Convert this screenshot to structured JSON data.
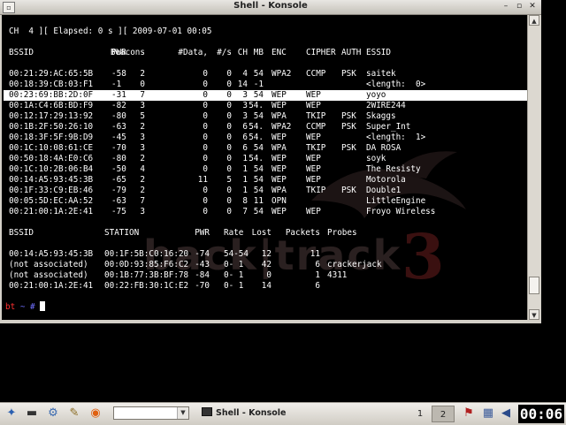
{
  "window": {
    "title": "Shell - Konsole",
    "menu_glyph": "▫",
    "btn_min": "–",
    "btn_max": "▫",
    "btn_close": "✕"
  },
  "terminal": {
    "status_line": "CH  4 ][ Elapsed: 0 s ][ 2009-07-01 00:05",
    "ap_headers": [
      "BSSID",
      "PWR",
      "Beacons",
      "#Data,",
      "#/s",
      "CH",
      "MB",
      "ENC",
      "CIPHER",
      "AUTH",
      "ESSID"
    ],
    "ap_rows": [
      [
        "00:21:29:AC:65:5B",
        "-58",
        "2",
        "0",
        "0",
        "4",
        "54",
        "WPA2",
        "CCMP",
        "PSK",
        "saitek"
      ],
      [
        "00:18:39:CB:03:F1",
        "-1",
        "0",
        "0",
        "0",
        "14",
        "-1",
        "",
        "",
        "",
        "<length:  0>"
      ],
      [
        "00:23:69:BB:2D:0F",
        "-31",
        "7",
        "0",
        "0",
        "3",
        "54",
        "WEP",
        "WEP",
        "",
        "yoyo"
      ],
      [
        "00:1A:C4:6B:BD:F9",
        "-82",
        "3",
        "0",
        "0",
        "3",
        "54.",
        "WEP",
        "WEP",
        "",
        "2WIRE244"
      ],
      [
        "00:12:17:29:13:92",
        "-80",
        "5",
        "0",
        "0",
        "3",
        "54",
        "WPA",
        "TKIP",
        "PSK",
        "Skaggs"
      ],
      [
        "00:1B:2F:50:26:10",
        "-63",
        "2",
        "0",
        "0",
        "6",
        "54.",
        "WPA2",
        "CCMP",
        "PSK",
        "Super_Int"
      ],
      [
        "00:18:3F:5F:9B:D9",
        "-45",
        "3",
        "0",
        "0",
        "6",
        "54.",
        "WEP",
        "WEP",
        "",
        "<length:  1>"
      ],
      [
        "00:1C:10:08:61:CE",
        "-70",
        "3",
        "0",
        "0",
        "6",
        "54",
        "WPA",
        "TKIP",
        "PSK",
        "DA ROSA"
      ],
      [
        "00:50:18:4A:E0:C6",
        "-80",
        "2",
        "0",
        "0",
        "1",
        "54.",
        "WEP",
        "WEP",
        "",
        "soyk"
      ],
      [
        "00:1C:10:2B:06:B4",
        "-50",
        "4",
        "0",
        "0",
        "1",
        "54",
        "WEP",
        "WEP",
        "",
        "The Resisty"
      ],
      [
        "00:14:A5:93:45:3B",
        "-65",
        "2",
        "11",
        "5",
        "1",
        "54",
        "WEP",
        "WEP",
        "",
        "Motorola"
      ],
      [
        "00:1F:33:C9:EB:46",
        "-79",
        "2",
        "0",
        "0",
        "1",
        "54",
        "WPA",
        "TKIP",
        "PSK",
        "Double1"
      ],
      [
        "00:05:5D:EC:AA:52",
        "-63",
        "7",
        "0",
        "0",
        "8",
        "11",
        "OPN",
        "",
        "",
        "LittleEngine"
      ],
      [
        "00:21:00:1A:2E:41",
        "-75",
        "3",
        "0",
        "0",
        "7",
        "54",
        "WEP",
        "WEP",
        "",
        "Froyo Wireless"
      ]
    ],
    "highlighted_row": 2,
    "sta_headers": [
      "BSSID",
      "STATION",
      "PWR",
      "Rate",
      "Lost",
      "Packets",
      "Probes"
    ],
    "sta_rows": [
      [
        "00:14:A5:93:45:3B",
        "00:1F:5B:C0:16:20",
        "-74",
        "54-54",
        "12",
        "11",
        ""
      ],
      [
        "(not associated)",
        "00:0D:93:85:F6:C2",
        "-43",
        "0- 1",
        "42",
        "6",
        "crackerjack"
      ],
      [
        "(not associated)",
        "00:1B:77:3B:BF:78",
        "-84",
        "0- 1",
        "0",
        "1",
        "4311"
      ],
      [
        "00:21:00:1A:2E:41",
        "00:22:FB:30:1C:E2",
        "-70",
        "0- 1",
        "14",
        "6",
        ""
      ]
    ],
    "prompt_user": "bt",
    "prompt_path": "~ #",
    "wallpaper_text": "back|track",
    "wallpaper_num": "3"
  },
  "scrollbar": {
    "up": "▲",
    "down": "▼"
  },
  "taskbar": {
    "kmenu_icon": "✦",
    "konsole_icon": "▬",
    "network_icon": "⚙",
    "editor_icon": "✎",
    "firefox_icon": "◉",
    "search_placeholder": "",
    "dropdown_arrow": "▼",
    "task_label": "Shell - Konsole",
    "desktop1": "1",
    "desktop2": "2",
    "flag_icon": "⚑",
    "tray_icon": "▦",
    "volume_icon": "◀",
    "clock": "00:06"
  },
  "colors": {
    "terminal_bg": "#000000",
    "highlight": "#ffffff",
    "prompt_user": "#ff3030",
    "prompt_path": "#7070ff"
  }
}
